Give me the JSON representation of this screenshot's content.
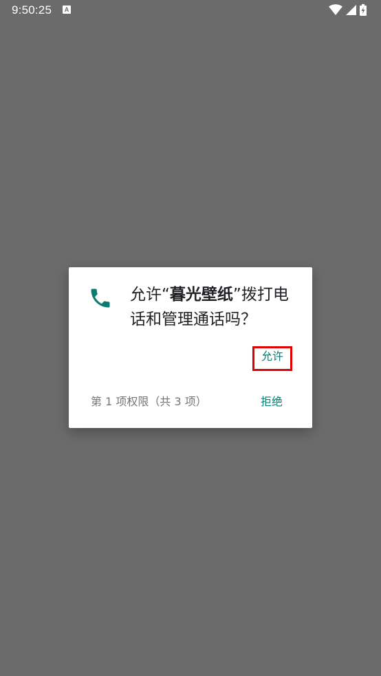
{
  "status_bar": {
    "time": "9:50:25",
    "notification_icon": "A"
  },
  "dialog": {
    "icon": "phone-icon",
    "title_prefix": "允许“",
    "app_name": "暮光壁纸",
    "title_suffix": "”拨打电话和管理通话吗？",
    "allow_label": "允许",
    "deny_label": "拒绝",
    "counter": "第 1 项权限（共 3 项）"
  },
  "colors": {
    "accent": "#0a7c72",
    "overlay": "#6b6b6b",
    "highlight": "#e10000"
  }
}
